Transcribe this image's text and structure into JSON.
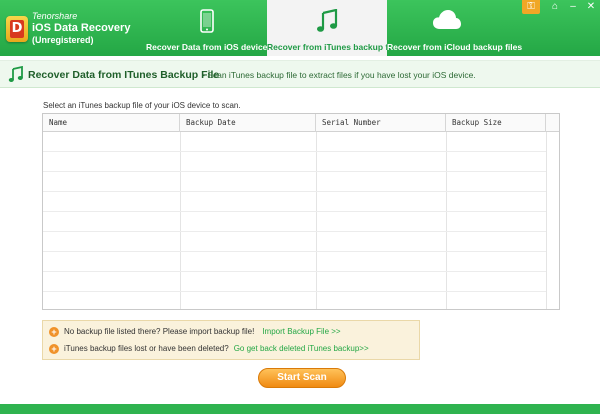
{
  "app": {
    "brand_line1": "Tenorshare",
    "brand_line2": "iOS Data Recovery",
    "brand_line3": "(Unregistered)",
    "logo_letter": "D"
  },
  "tabs": [
    {
      "label": "Recover Data from iOS device",
      "icon": "phone-icon",
      "active": false
    },
    {
      "label": "Recover from iTunes backup files",
      "icon": "music-note-icon",
      "active": true
    },
    {
      "label": "Recover from iCloud backup files",
      "icon": "cloud-icon",
      "active": false
    }
  ],
  "window_controls": {
    "key": "⚿",
    "home": "⌂",
    "minimize": "–",
    "close": "✕"
  },
  "subheader": {
    "title": "Recover Data from ITunes Backup File",
    "description": "- Scan iTunes backup file to extract files if you have lost your iOS device."
  },
  "content": {
    "instruction": "Select an iTunes backup file of your iOS device to scan.",
    "table": {
      "columns": [
        "Name",
        "Backup Date",
        "Serial Number",
        "Backup Size"
      ],
      "rows": []
    }
  },
  "info": {
    "row1_text": "No backup file listed there? Please import backup file!",
    "row1_link": "Import Backup File >>",
    "row2_text": "iTunes backup files lost or have been deleted?",
    "row2_link": "Go get back deleted iTunes backup>>"
  },
  "actions": {
    "start_scan": "Start Scan"
  },
  "colors": {
    "brand_green": "#2fb34f",
    "accent_orange": "#f08a12",
    "link_green": "#24a745"
  }
}
